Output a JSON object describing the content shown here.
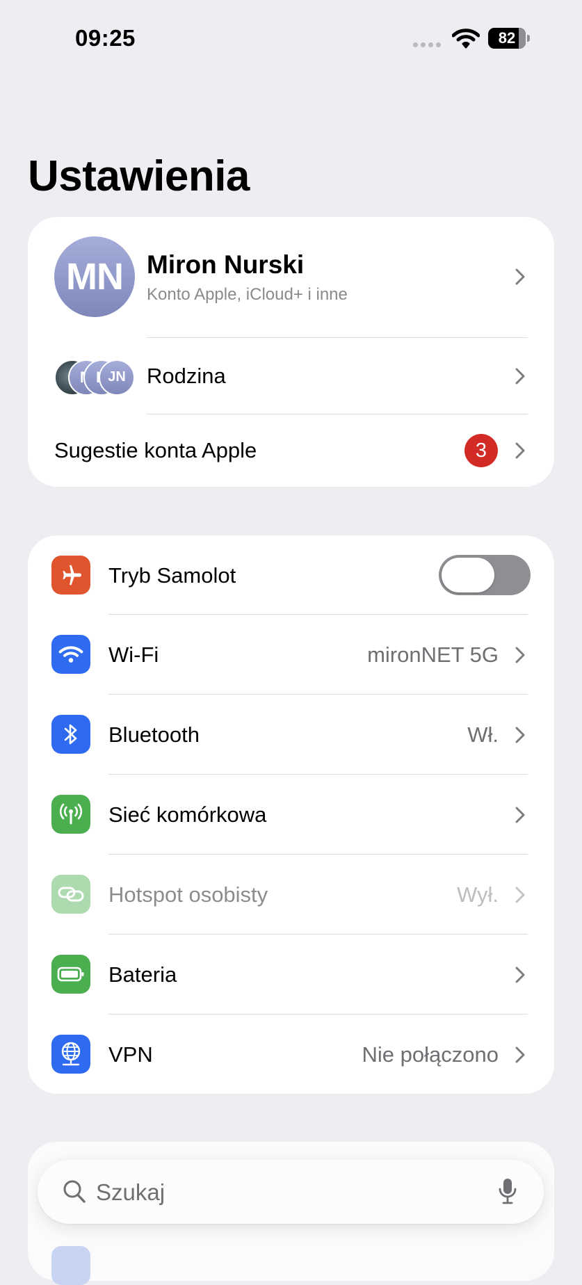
{
  "status_bar": {
    "time": "09:25",
    "battery_level": "82",
    "battery_percent": 82
  },
  "page": {
    "title": "Ustawienia"
  },
  "account": {
    "avatar_initials": "MN",
    "name": "Miron Nurski",
    "subtitle": "Konto Apple, iCloud+ i inne",
    "family_label": "Rodzina",
    "family_avatars": [
      "",
      "M",
      "K",
      "JN"
    ],
    "suggestions_label": "Sugestie konta Apple",
    "suggestions_badge": "3"
  },
  "network": {
    "airplane": {
      "label": "Tryb Samolot",
      "on": false,
      "color": "#E0552E"
    },
    "wifi": {
      "label": "Wi-Fi",
      "value": "mironNET 5G",
      "color": "#2F6BF0"
    },
    "bluetooth": {
      "label": "Bluetooth",
      "value": "Wł.",
      "color": "#2F6BF0"
    },
    "cellular": {
      "label": "Sieć komórkowa",
      "value": "",
      "color": "#4BAE4F"
    },
    "hotspot": {
      "label": "Hotspot osobisty",
      "value": "Wył.",
      "color": "#4BAE4F",
      "disabled": true
    },
    "battery": {
      "label": "Bateria",
      "value": "",
      "color": "#4BAE4F"
    },
    "vpn": {
      "label": "VPN",
      "value": "Nie połączono",
      "color": "#2F6BF0"
    }
  },
  "search": {
    "placeholder": "Szukaj"
  },
  "icons": {
    "airplane": "airplane-icon",
    "wifi": "wifi-icon",
    "bluetooth": "bluetooth-icon",
    "cellular": "antenna-icon",
    "hotspot": "link-icon",
    "battery": "battery-icon",
    "vpn": "globe-icon",
    "search": "magnifier-icon",
    "mic": "microphone-icon",
    "chevron": "chevron-right-icon"
  }
}
